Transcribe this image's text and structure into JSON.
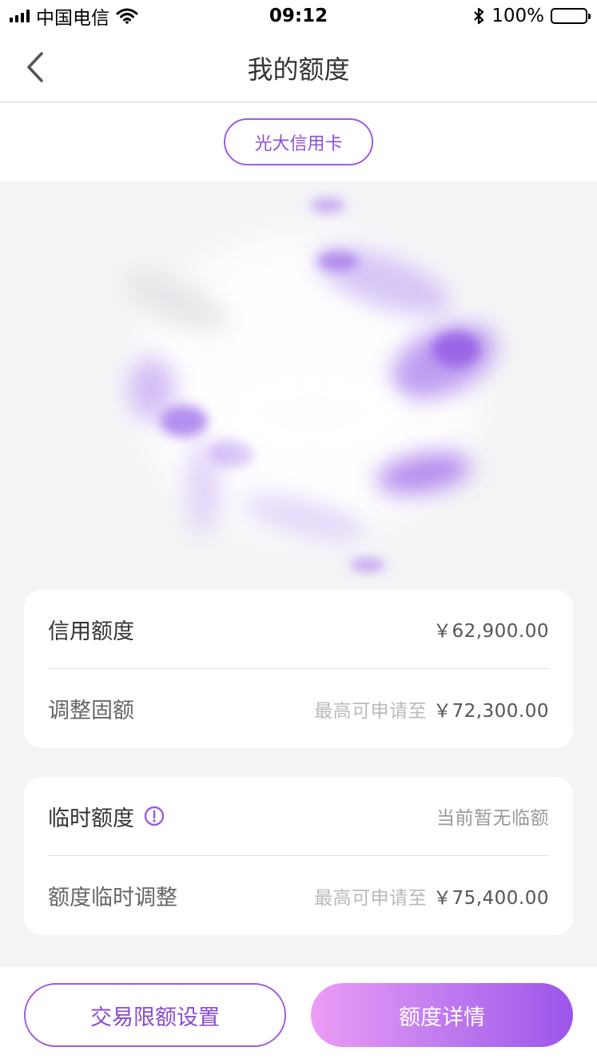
{
  "status_bar": {
    "carrier": "中国电信",
    "time": "09:12",
    "battery": "100%",
    "icons": [
      "signal-icon",
      "wifi-icon",
      "bluetooth-icon",
      "battery-icon"
    ]
  },
  "nav": {
    "title": "我的额度",
    "back_icon": "chevron-left-icon"
  },
  "card_selector": {
    "label": "光大信用卡"
  },
  "credit_limit": {
    "label": "信用额度",
    "value": "￥62,900.00"
  },
  "fixed_adjust": {
    "label": "调整固额",
    "hint": "最高可申请至",
    "value": "￥72,300.00"
  },
  "temp_limit": {
    "label": "临时额度",
    "info_icon": "info-icon",
    "value": "当前暂无临额"
  },
  "temp_adjust": {
    "label": "额度临时调整",
    "hint": "最高可申请至",
    "value": "￥75,400.00"
  },
  "actions": {
    "limit_settings": "交易限额设置",
    "limit_details": "额度详情"
  },
  "colors": {
    "accent": "#9d5ce0",
    "gradient_start": "#ec9df5",
    "gradient_end": "#9b55ea",
    "page_bg": "#f4f4f6"
  }
}
